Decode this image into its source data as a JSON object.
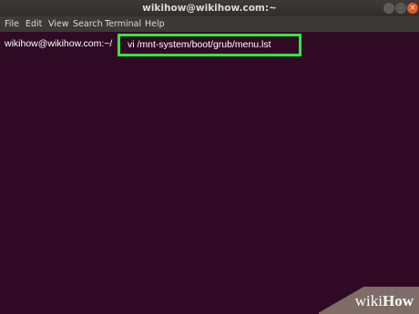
{
  "window": {
    "title": "wikihow@wikihow.com:~",
    "buttons": {
      "minimize": "–",
      "maximize": "□",
      "close": "×"
    }
  },
  "menu": [
    "File",
    "Edit",
    "View",
    "Search",
    "Terminal",
    "Help"
  ],
  "terminal": {
    "prompt": "wikihow@wikihow.com:~/",
    "command": "vi /mnt-system/boot/grub/menu.lst"
  },
  "watermark": {
    "wiki": "wiki",
    "how": "How"
  },
  "colors": {
    "terminal_bg": "#300a24",
    "titlebar_bg": "#3c3b37",
    "highlight_border": "#2ee93a",
    "close_button": "#e95420"
  }
}
